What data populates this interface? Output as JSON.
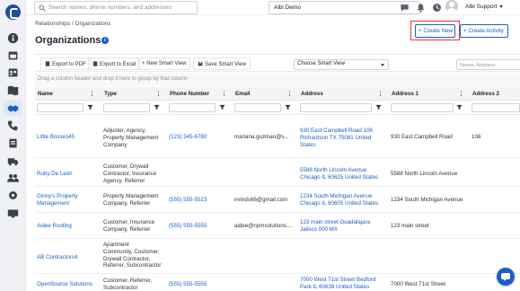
{
  "search": {
    "placeholder": "Search names, phone numbers, and addresses"
  },
  "topbar": {
    "company": "Albi Demo",
    "user": "Albi Support"
  },
  "breadcrumb": "Relationships / Organizations",
  "page": {
    "title": "Organizations",
    "info": "i"
  },
  "actions": {
    "create_new": "+ Create New",
    "create_activity": "+ Create Activity"
  },
  "toolbar": {
    "export_pdf": "Export to PDF",
    "export_excel": "Export to Excel",
    "new_smart_view": "+ New Smart View",
    "save_smart_view": "Save Smart View",
    "choose_smart_view": "Choose Smart View",
    "name_address_placeholder": "Name, Address"
  },
  "group_hint": "Drag a column header and drop it here to group by that column",
  "columns": [
    "Name",
    "Type",
    "Phone Number",
    "Email",
    "Address",
    "Address 1",
    "Address 2"
  ],
  "rows": [
    {
      "name": "Little Bosses45",
      "type": "Adjuster, Agency,\nProperty Management\nCompany",
      "phone": "(123) 345-6780",
      "email": "mariana.guzman@s...",
      "address": "930 East Campbell Road 106\nRichardson TX 75081 United\nStates",
      "address1": "930 East Campbell Road",
      "address2": "106"
    },
    {
      "name": "Ruby De Leon",
      "type": "Customer, Drywall\nContractor, Insurance\nAgency, Referrer",
      "phone": "",
      "email": "",
      "address": "5588 North Lincoln Avenue\nChicago IL 60625 United States",
      "address1": "5588 North Lincoln Avenue",
      "address2": ""
    },
    {
      "name": "Ginny's Property\nManagement",
      "type": "Property Management\nCompany, Referrer",
      "phone": "(555) 555-5523",
      "email": "irvinds66@gmail.com",
      "address": "1234 South Michigan Avenue\nChicago IL 60605 United States",
      "address1": "1234 South Michigan Avenue",
      "address2": ""
    },
    {
      "name": "Aidee Roofing",
      "type": "Customer, Insurance\nCompany, Referrer",
      "phone": "(555) 555-5555",
      "email": "aidee@npmsolutions....",
      "address": "123 main street Guadalajara\nJalisco 000 MX",
      "address1": "123 main street",
      "address2": ""
    },
    {
      "name": "AB Contractors4",
      "type": "Apartment\nCommunity, Customer,\nDrywall Contractor,\nReferrer, Subcontractor",
      "phone": "",
      "email": "",
      "address": "",
      "address1": "",
      "address2": ""
    },
    {
      "name": "OpenSource Solutions",
      "type": "Customer, Referrer,\nSubcontractor",
      "phone": "(555) 555-5555",
      "email": "",
      "address": "7000 West 71st Street Bedford\nPark IL 60638 United States",
      "address1": "7000 West 71st Street",
      "address2": ""
    }
  ]
}
